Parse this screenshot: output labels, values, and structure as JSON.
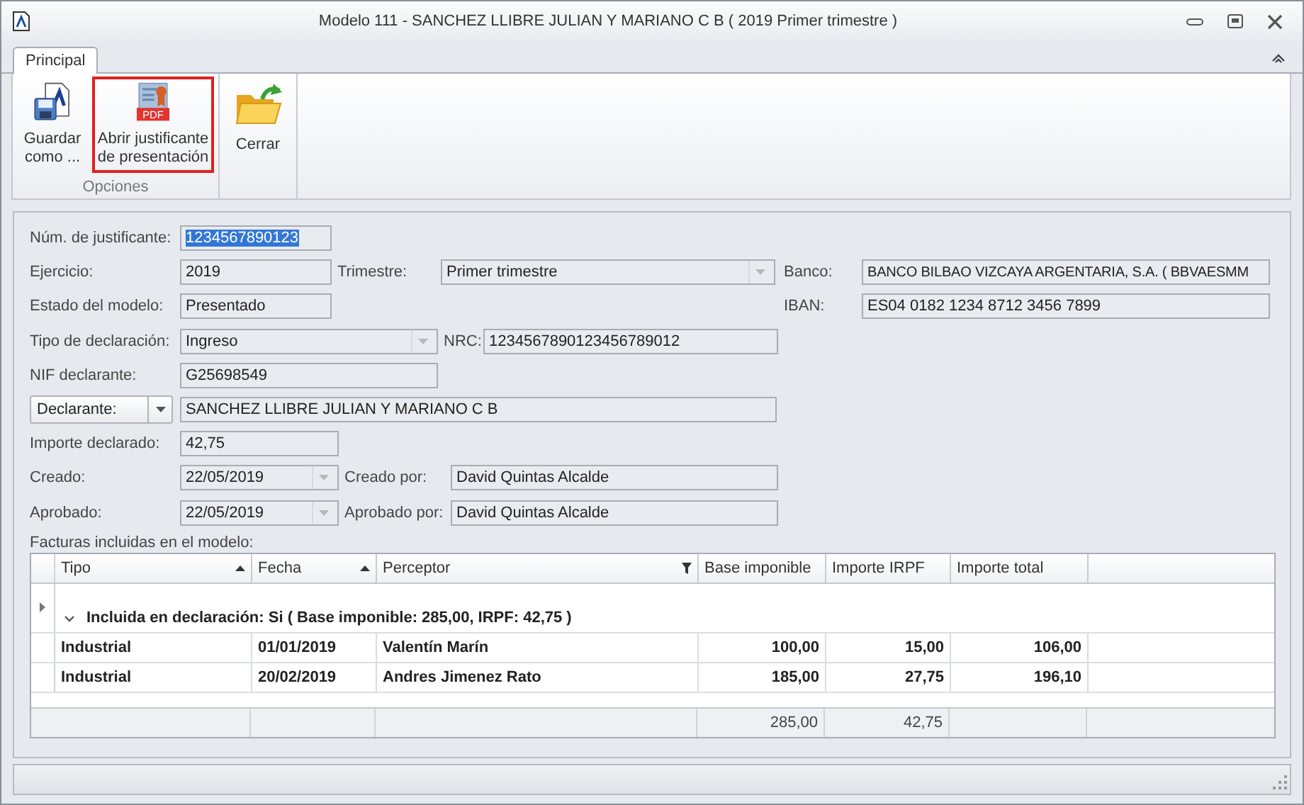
{
  "window": {
    "title": "Modelo 111 -  SANCHEZ LLIBRE JULIAN Y MARIANO C B ( 2019 Primer trimestre )"
  },
  "ribbon": {
    "tabs": [
      {
        "label": "Principal",
        "selected": true
      }
    ],
    "groups": [
      {
        "label": "Opciones",
        "buttons": [
          {
            "label": "Guardar como ...",
            "kind": "save",
            "highlighted": false
          },
          {
            "label": "Abrir justificante de presentación",
            "kind": "pdf",
            "icon_text": "PDF",
            "highlighted": true
          }
        ]
      },
      {
        "buttons": [
          {
            "label": "Cerrar",
            "kind": "folder",
            "highlighted": false
          }
        ]
      }
    ]
  },
  "form": {
    "justificante": {
      "label": "Núm. de justificante:",
      "value": "1234567890123",
      "selected": true
    },
    "ejercicio": {
      "label": "Ejercicio:",
      "value": "2019"
    },
    "trimestre": {
      "label": "Trimestre:",
      "value": "Primer trimestre",
      "dropdown": true
    },
    "banco": {
      "label": "Banco:",
      "value": "BANCO BILBAO VIZCAYA ARGENTARIA, S.A. ( BBVAESMM"
    },
    "estado": {
      "label": "Estado del modelo:",
      "value": "Presentado"
    },
    "iban": {
      "label": "IBAN:",
      "value": "ES04 0182 1234 8712 3456 7899"
    },
    "tipo": {
      "label": "Tipo de declaración:",
      "value": "Ingreso",
      "dropdown": true
    },
    "nrc": {
      "label": "NRC:",
      "value": "1234567890123456789012"
    },
    "nif": {
      "label": "NIF declarante:",
      "value": "G25698549"
    },
    "declarante": {
      "selector": "Declarante:",
      "value": "SANCHEZ LLIBRE JULIAN Y MARIANO C B"
    },
    "importe": {
      "label": "Importe declarado:",
      "value": "42,75"
    },
    "creado": {
      "label": "Creado:",
      "value": "22/05/2019",
      "dropdown": true
    },
    "creado_por": {
      "label": "Creado por:",
      "value": "David Quintas Alcalde"
    },
    "aprobado": {
      "label": "Aprobado:",
      "value": "22/05/2019",
      "dropdown": true
    },
    "aprobado_por": {
      "label": "Aprobado por:",
      "value": "David Quintas Alcalde"
    }
  },
  "grid": {
    "caption": "Facturas incluidas en el modelo:",
    "columns": [
      {
        "label": "Tipo",
        "sorted_ascending": true
      },
      {
        "label": "Fecha",
        "sorted_ascending": true
      },
      {
        "label": "Perceptor",
        "filter": true
      },
      {
        "label": "Base imponible"
      },
      {
        "label": "Importe IRPF"
      },
      {
        "label": "Importe total"
      }
    ],
    "group": {
      "label": "Incluida en declaración: Si ( Base imponible: 285,00,  IRPF: 42,75 )",
      "expanded": true
    },
    "rows": [
      [
        "Industrial",
        "01/01/2019",
        "Valentín Marín",
        "100,00",
        "15,00",
        "106,00"
      ],
      [
        "Industrial",
        "20/02/2019",
        "Andres Jimenez Rato",
        "185,00",
        "27,75",
        "196,10"
      ]
    ],
    "totals": {
      "base_imponible": "285,00",
      "importe_irpf": "42,75"
    }
  }
}
